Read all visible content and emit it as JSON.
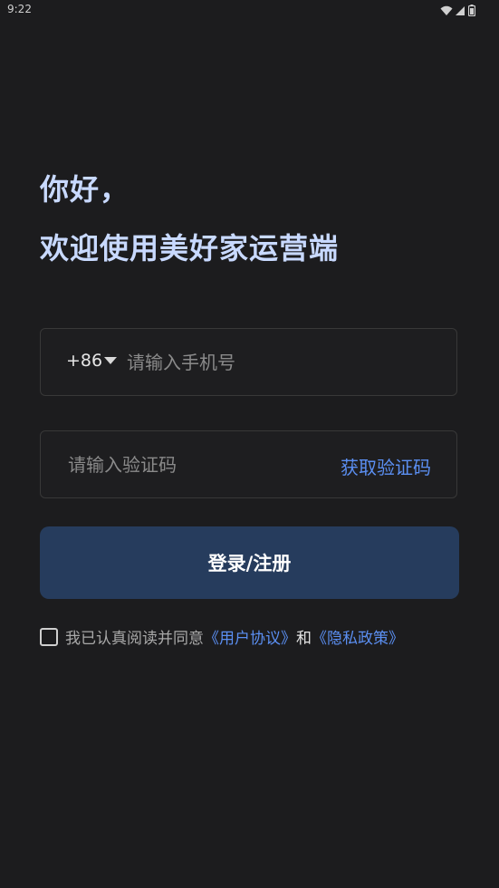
{
  "status_bar": {
    "time": "9:22",
    "icons": [
      "wifi-icon",
      "signal-icon",
      "battery-icon"
    ]
  },
  "greeting": {
    "line1": "你好，",
    "line2": "欢迎使用美好家运营端"
  },
  "phone_field": {
    "country_code": "+86",
    "placeholder": "请输入手机号",
    "value": ""
  },
  "code_field": {
    "placeholder": "请输入验证码",
    "value": "",
    "get_code_label": "获取验证码"
  },
  "login_button": {
    "label": "登录/注册"
  },
  "agreement": {
    "checked": false,
    "text": "我已认真阅读并同意",
    "user_agreement": "《用户协议》",
    "and": "和",
    "privacy_policy": "《隐私政策》"
  },
  "colors": {
    "background": "#1c1c1e",
    "greeting": "#c8d9ff",
    "accent_link": "#5b8ff2",
    "button": "#263c5d"
  }
}
